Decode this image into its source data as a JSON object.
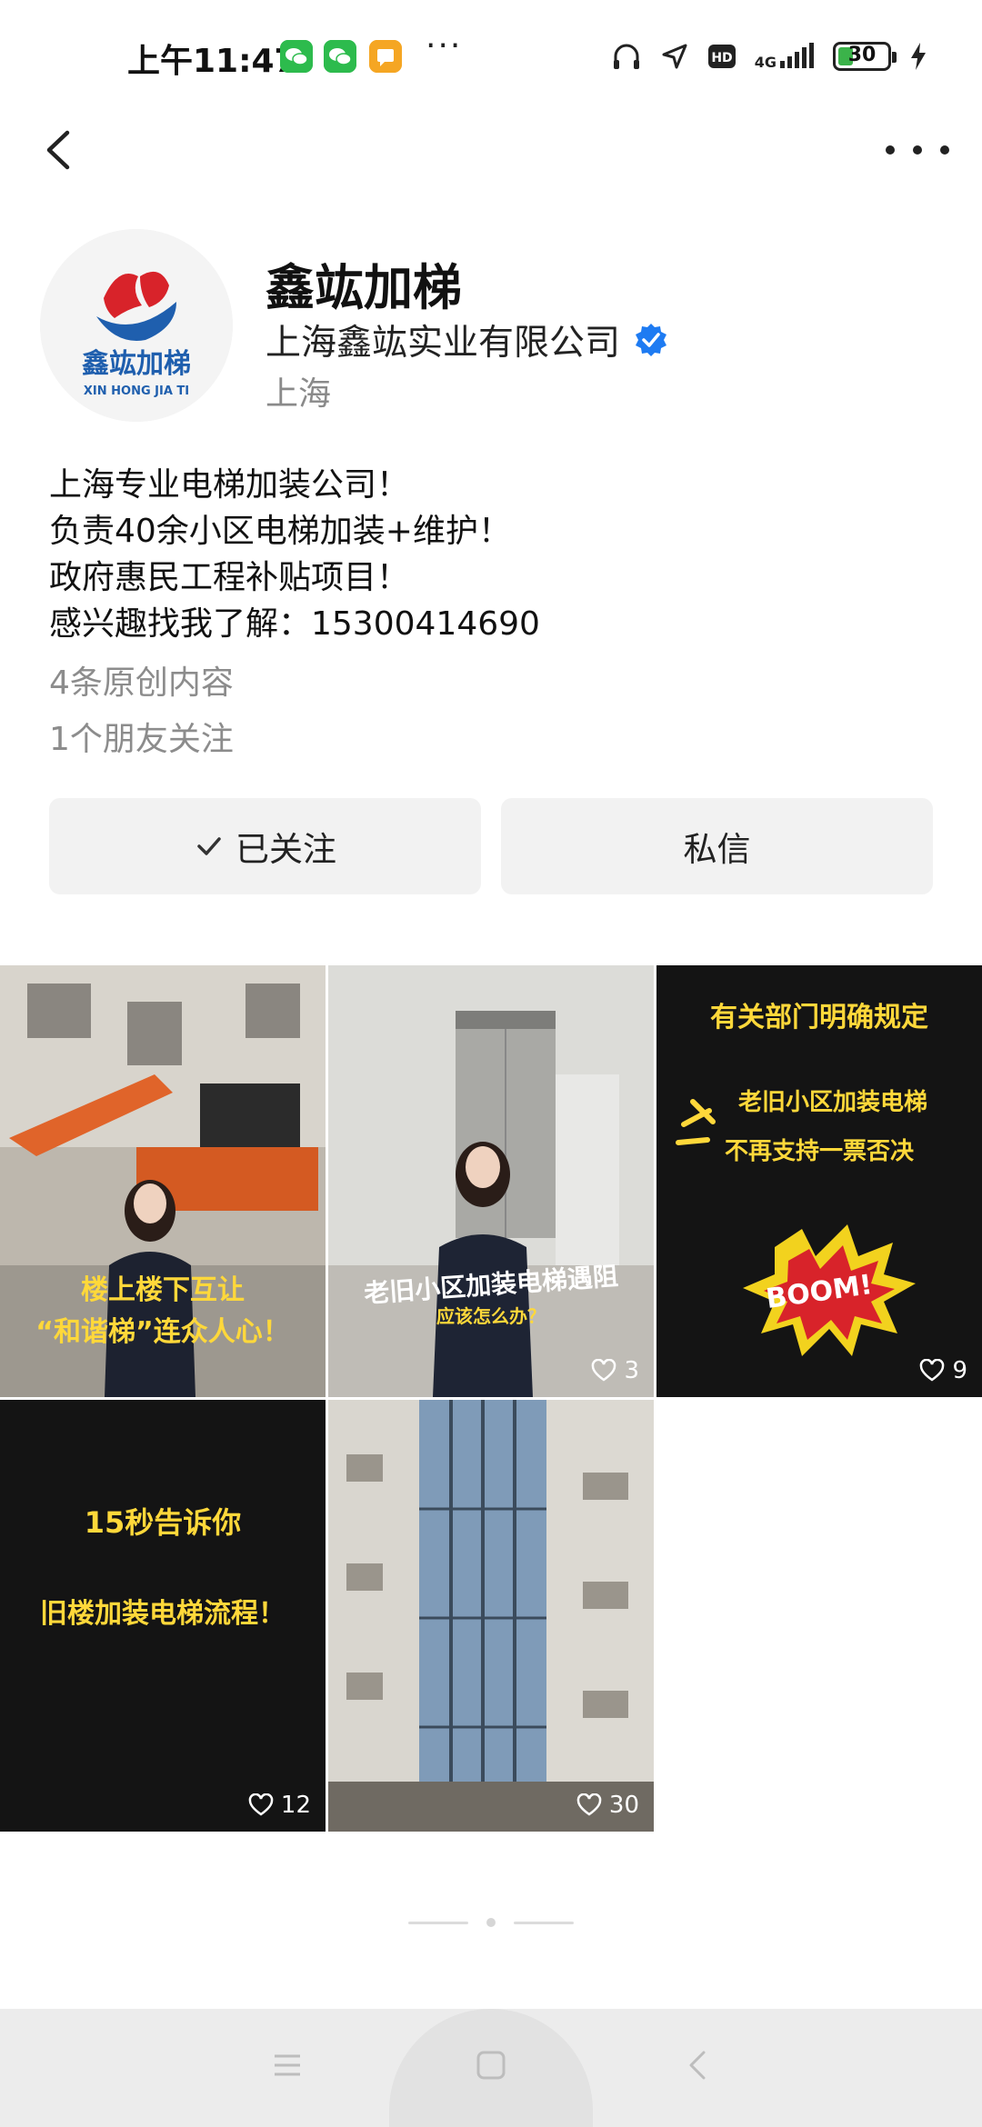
{
  "status_bar": {
    "time": "上午11:47",
    "more": "···",
    "network_top": "4G",
    "battery": "30",
    "battery_color": "#3bb34a"
  },
  "nav": {
    "back_icon": "chevron-left-icon",
    "more_icon": "more-horizontal-icon"
  },
  "profile": {
    "name": "鑫竑加梯",
    "company": "上海鑫竑实业有限公司",
    "verified": true,
    "verified_color": "#1e7bf2",
    "location": "上海",
    "avatar_logo_title": "鑫竑加梯",
    "avatar_logo_subtitle": "XIN HONG JIA TI",
    "bio": [
      "上海专业电梯加装公司！",
      "负责40余小区电梯加装+维护！",
      "政府惠民工程补贴项目！",
      "感兴趣找我了解：15300414690"
    ],
    "original_count": "4条原创内容",
    "friends_following": "1个朋友关注"
  },
  "actions": {
    "follow_label": "已关注",
    "message_label": "私信"
  },
  "grid": [
    {
      "caption_line1": "楼上楼下互让",
      "caption_line2": "“和谐梯”连众人心！",
      "likes": ""
    },
    {
      "caption_line1": "老旧小区加装电梯遇阻",
      "caption_line2": "应该怎么办？",
      "likes": "3"
    },
    {
      "caption_line1": "有关部门明确规定",
      "caption_line2": "老旧小区加装电梯",
      "caption_line3": "不再支持一票否决",
      "badge": "BOOM!",
      "likes": "9"
    },
    {
      "caption_line1": "15秒告诉你",
      "caption_line2": "旧楼加装电梯流程！",
      "likes": "12"
    },
    {
      "caption_line1": "",
      "caption_line2": "",
      "likes": "30"
    }
  ],
  "system_nav": {
    "menu_icon": "menu-icon",
    "home_icon": "home-square-icon",
    "back_icon": "back-triangle-icon"
  }
}
